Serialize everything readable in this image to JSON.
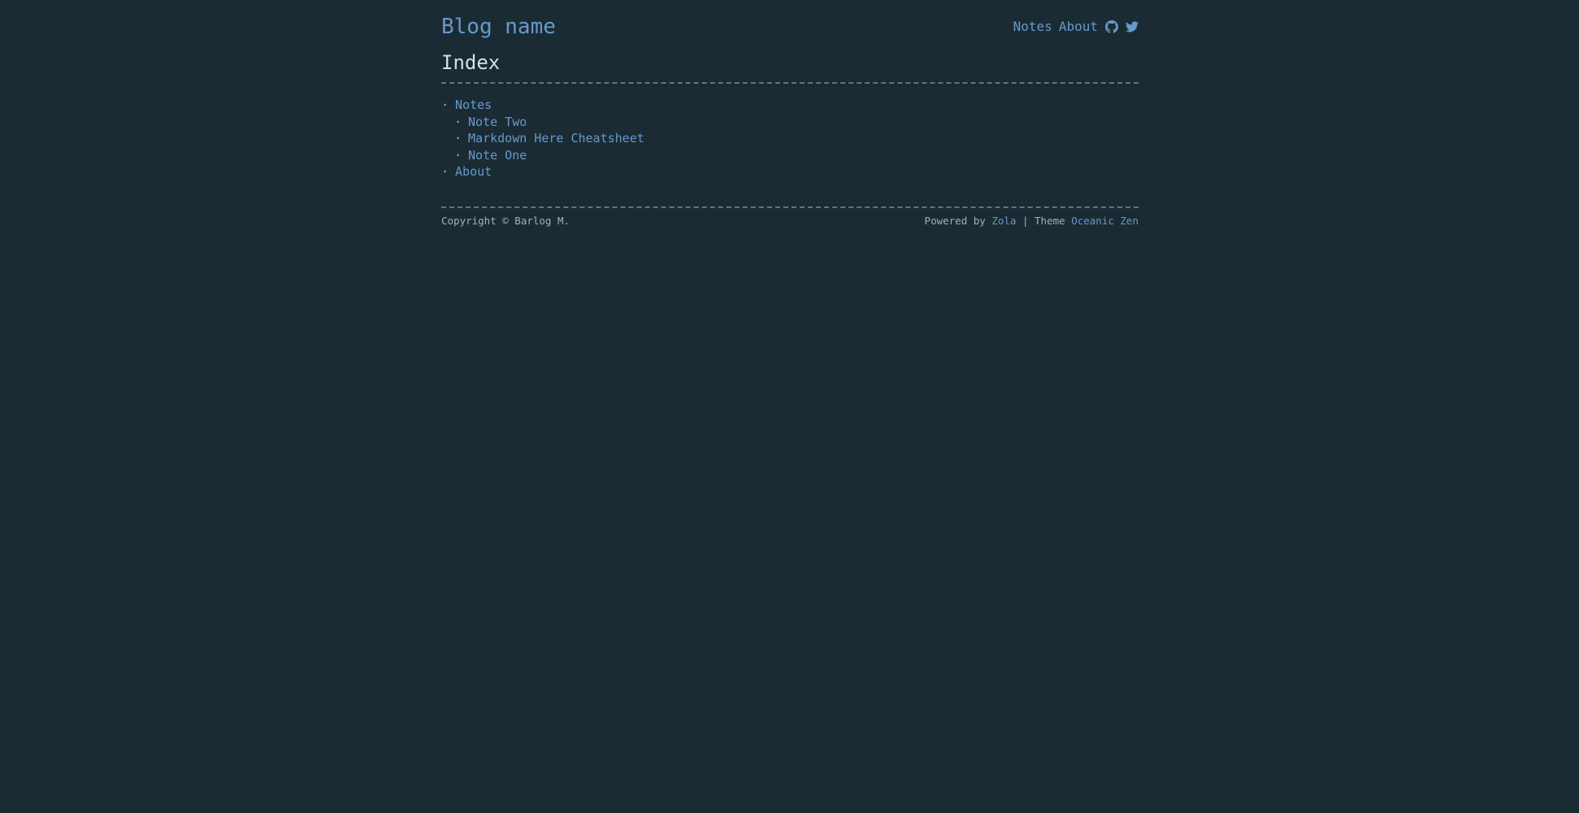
{
  "header": {
    "blog_name": "Blog name",
    "nav": [
      {
        "label": "Notes"
      },
      {
        "label": "About"
      }
    ],
    "icons": [
      "github-icon",
      "twitter-icon"
    ]
  },
  "page": {
    "title": "Index"
  },
  "index": {
    "items": [
      {
        "label": "Notes",
        "level": 0
      },
      {
        "label": "Note Two",
        "level": 1
      },
      {
        "label": "Markdown Here Cheatsheet",
        "level": 1
      },
      {
        "label": "Note One",
        "level": 1
      },
      {
        "label": "About",
        "level": 0
      }
    ],
    "bullet": "·"
  },
  "footer": {
    "copyright": "Copyright © Barlog M.",
    "powered_by_prefix": "Powered by",
    "engine": "Zola",
    "separator": "| Theme",
    "theme": "Oceanic Zen"
  },
  "colors": {
    "background": "#1b2b34",
    "link": "#6699cc",
    "text": "#c0c5ce",
    "rule": "#65737e"
  }
}
